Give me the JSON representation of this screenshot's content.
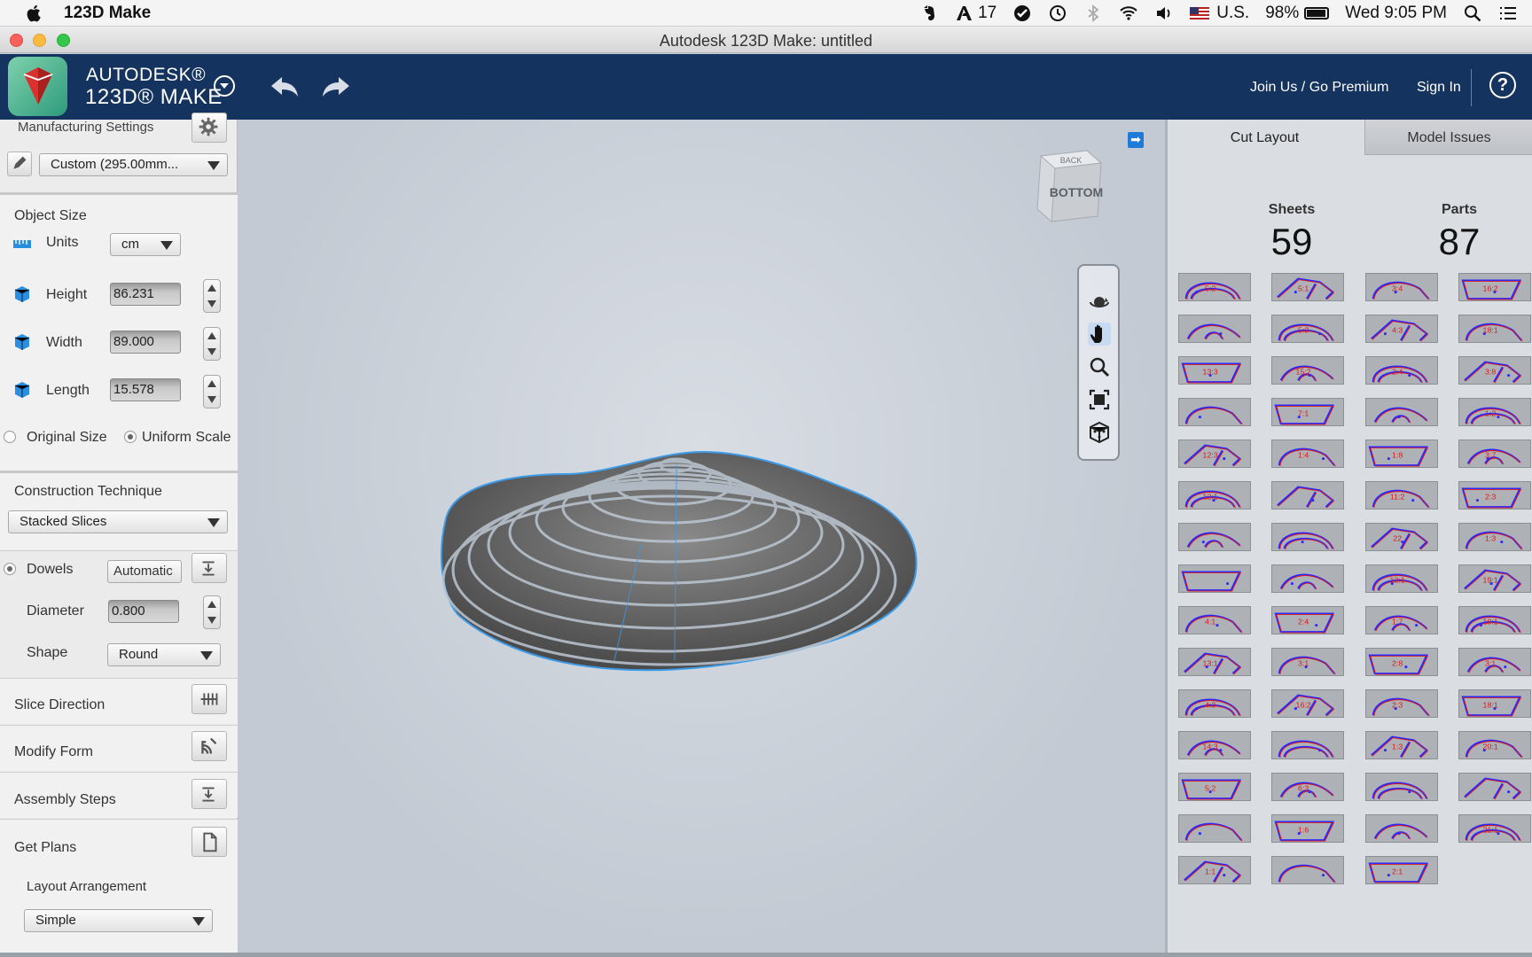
{
  "menubar": {
    "app_name": "123D Make",
    "notification_count": "17",
    "input_source": "U.S.",
    "battery": "98%",
    "clock": "Wed 9:05 PM"
  },
  "window": {
    "title": "Autodesk 123D Make: untitled"
  },
  "header": {
    "brand_top": "AUTODESK®",
    "brand_bottom": "123D® MAKE",
    "join_label": "Join Us / Go Premium",
    "signin_label": "Sign In",
    "help_label": "?"
  },
  "left_panel": {
    "manufacturing_title": "Manufacturing Settings",
    "material_value": "Custom (295.00mm...",
    "object_size_title": "Object Size",
    "units_label": "Units",
    "units_value": "cm",
    "height_label": "Height",
    "height_value": "86.231",
    "width_label": "Width",
    "width_value": "89.000",
    "length_label": "Length",
    "length_value": "15.578",
    "original_size_label": "Original Size",
    "uniform_scale_label": "Uniform Scale",
    "construction_title": "Construction Technique",
    "construction_value": "Stacked Slices",
    "dowels_label": "Dowels",
    "dowels_value": "Automatic",
    "diameter_label": "Diameter",
    "diameter_value": "0.800",
    "shape_label": "Shape",
    "shape_value": "Round",
    "slice_direction": "Slice Direction",
    "modify_form": "Modify Form",
    "assembly_steps": "Assembly Steps",
    "get_plans": "Get Plans",
    "layout_arrangement_label": "Layout Arrangement",
    "layout_arrangement_value": "Simple"
  },
  "viewport": {
    "viewcube_face": "BOTTOM",
    "viewcube_top": "BACK",
    "nav_tools": [
      "orbit-icon",
      "pan-icon",
      "zoom-icon",
      "fit-icon",
      "home-icon"
    ]
  },
  "right_panel": {
    "tabs": [
      "Cut Layout",
      "Model Issues"
    ],
    "sheets_label": "Sheets",
    "sheets_value": "59",
    "parts_label": "Parts",
    "parts_value": "87"
  },
  "thumbnail_labels": [
    "5:2",
    "5:1",
    "3:4",
    "16:2",
    "",
    "5:3",
    "4:3",
    "18:1",
    "13:3",
    "15:2",
    "2:4",
    "3:8",
    "",
    "7:1",
    "",
    "1:2",
    "12:3",
    "1:4",
    "1:8",
    "3:7",
    "12:1",
    "",
    "11:2",
    "2:3",
    "",
    "",
    "22",
    "1:3",
    "",
    "",
    "12:1",
    "19:1",
    "4:1",
    "2:4",
    "1:7",
    "19:1",
    "13:1",
    "3:1",
    "2:8",
    "3:1",
    "4:3",
    "16:2",
    "2:3",
    "18:1",
    "14:3",
    "",
    "1:3",
    "20:1",
    "5:2",
    "6:3",
    "",
    "",
    "",
    "1:6",
    "",
    "21:1",
    "1:1",
    "",
    "2:1"
  ],
  "colors": {
    "header_bg": "#14335e",
    "accent": "#1f7ad8",
    "cut_red": "#e01818",
    "cut_blue": "#2a2aff"
  }
}
